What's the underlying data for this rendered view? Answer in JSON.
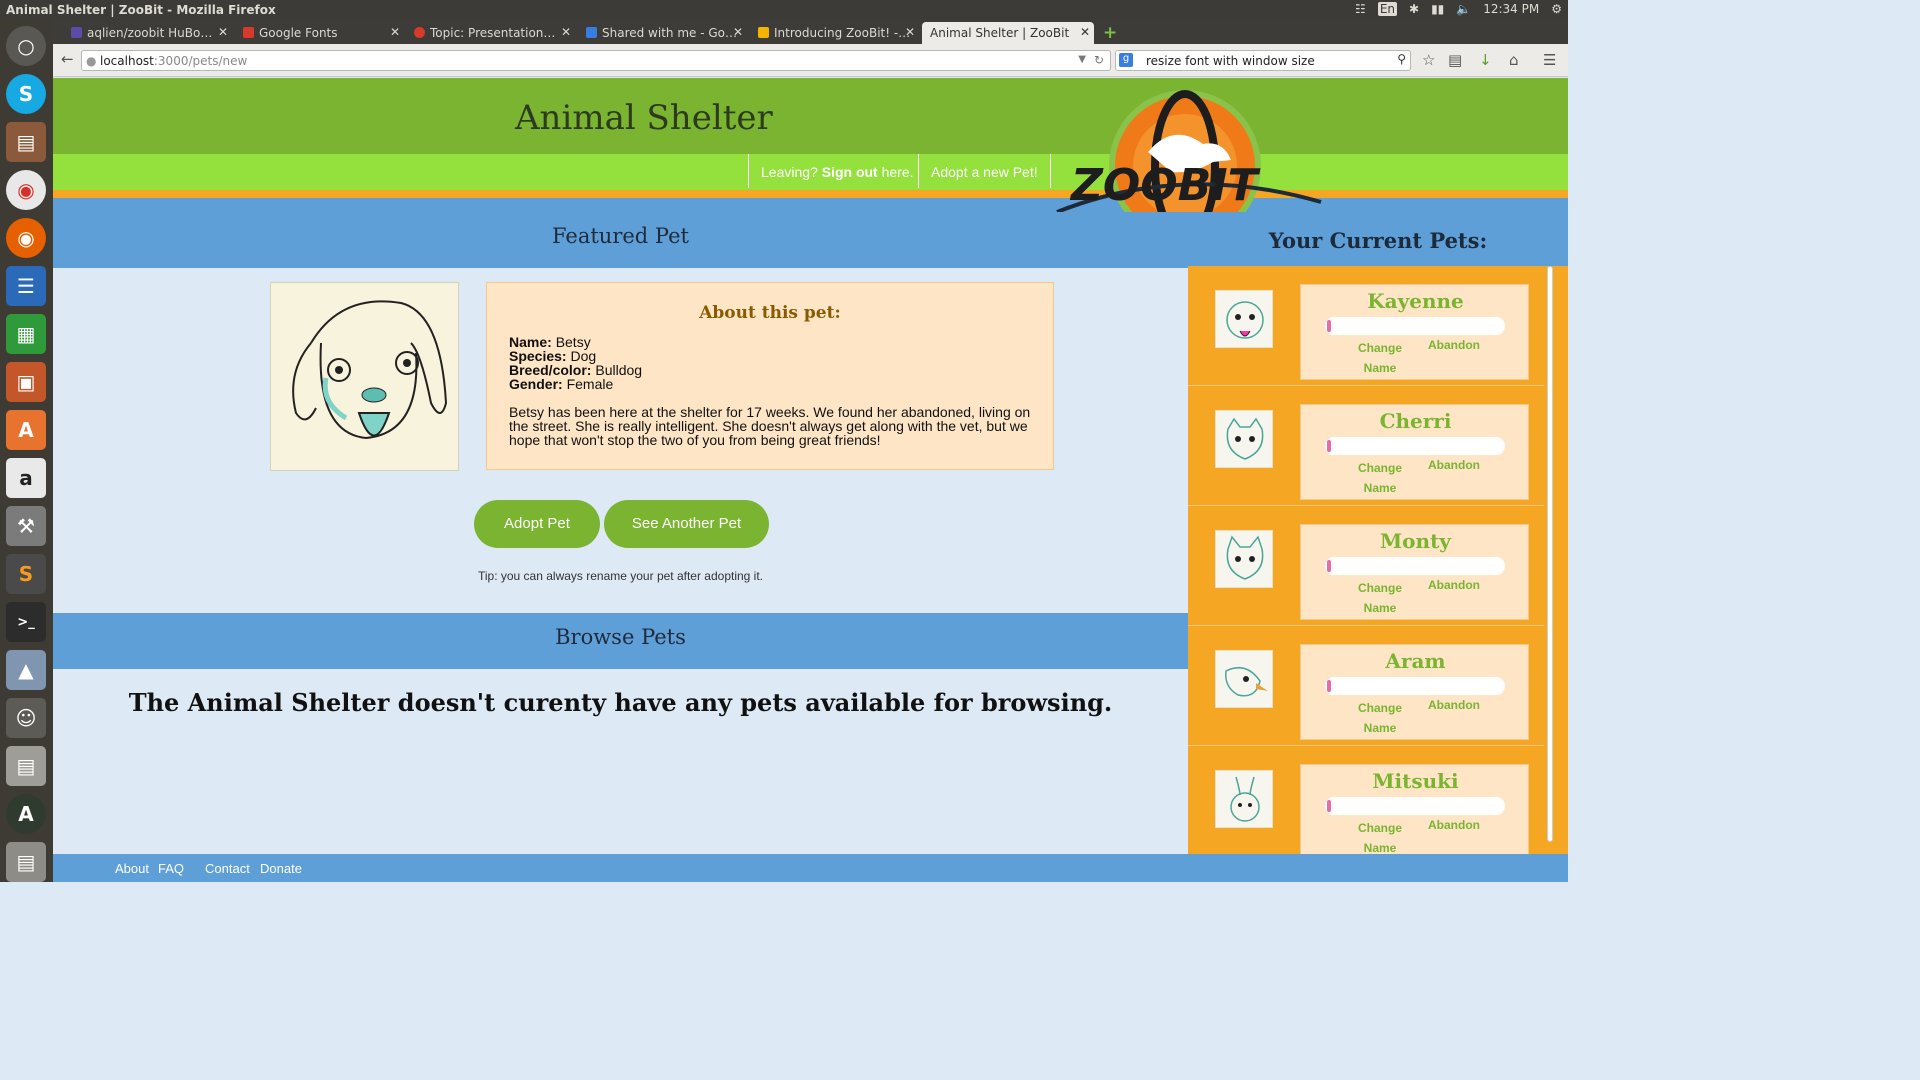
{
  "os": {
    "window_title": "Animal Shelter | ZooBit - Mozilla Firefox",
    "keyboard": "En",
    "time": "12:34 PM"
  },
  "tabs": [
    {
      "label": "aqlien/zoobit HuBo…",
      "icon": "github-icon",
      "color": "#5d4ba8"
    },
    {
      "label": "Google Fonts",
      "icon": "google-fonts-icon",
      "color": "#d7392b"
    },
    {
      "label": "Topic: Presentation…",
      "icon": "forum-icon",
      "color": "#d7392b"
    },
    {
      "label": "Shared with me - Go…",
      "icon": "google-drive-icon",
      "color": "#3a7de0"
    },
    {
      "label": "Introducing ZooBit! -…",
      "icon": "slides-icon",
      "color": "#f4b400"
    },
    {
      "label": "Animal Shelter | ZooBit",
      "icon": "",
      "color": ""
    }
  ],
  "nav": {
    "url_host": "localhost",
    "url_path": ":3000/pets/new",
    "search_value": "resize font with window size"
  },
  "site": {
    "title": "Animal Shelter",
    "logo_text": "ZOOBIT",
    "menu": {
      "leaving_prefix": "Leaving? ",
      "sign_out": "Sign out",
      "leaving_suffix": " here.",
      "adopt_new": "Adopt a new Pet!"
    }
  },
  "featured": {
    "heading": "Featured Pet",
    "about_heading": "About this pet:",
    "name_label": "Name:",
    "name": "Betsy",
    "species_label": "Species:",
    "species": "Dog",
    "breed_label": "Breed/color:",
    "breed": "Bulldog",
    "gender_label": "Gender:",
    "gender": "Female",
    "description": "Betsy has been here at the shelter for 17 weeks. We found her abandoned, living on the street. She is really intelligent. She doesn't always get along with the vet, but we hope that won't stop the two of you from being great friends!",
    "adopt_button": "Adopt Pet",
    "another_button": "See Another Pet",
    "tip": "Tip: you can always rename your pet after adopting it."
  },
  "browse": {
    "heading": "Browse Pets",
    "empty_message": "The Animal Shelter doesn't curenty have any pets available for browsing."
  },
  "sidebar": {
    "title": "Your Current Pets:",
    "change_label": "Change",
    "name_label": "Name",
    "abandon_label": "Abandon",
    "pets": [
      {
        "name": "Kayenne",
        "happiness": 0.02
      },
      {
        "name": "Cherri",
        "happiness": 0.02
      },
      {
        "name": "Monty",
        "happiness": 0.02
      },
      {
        "name": "Aram",
        "happiness": 0.02
      },
      {
        "name": "Mitsuki",
        "happiness": 0.02
      }
    ]
  },
  "footer": {
    "about": "About",
    "faq": "FAQ",
    "contact": "Contact",
    "donate": "Donate"
  },
  "colors": {
    "header_green": "#7ab431",
    "menu_green": "#94e03c",
    "orange": "#f5a623",
    "blue": "#5f9fd8",
    "light_blue": "#dde9f5",
    "card": "#fde5c6"
  }
}
